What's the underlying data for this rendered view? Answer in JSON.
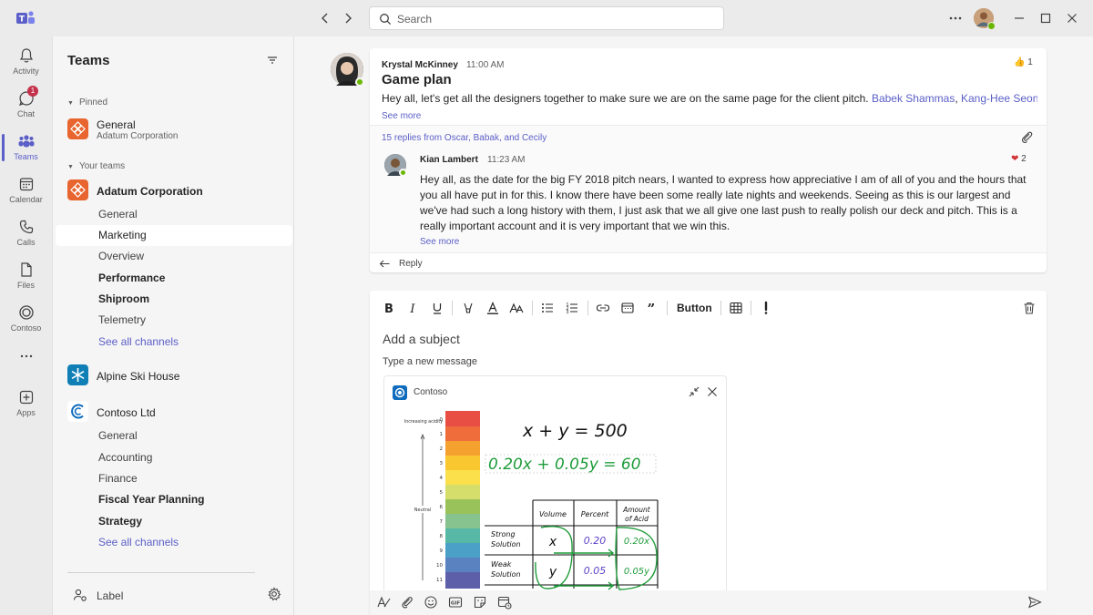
{
  "search": {
    "placeholder": "Search"
  },
  "rail": {
    "items": [
      {
        "label": "Activity",
        "icon": "bell-icon"
      },
      {
        "label": "Chat",
        "icon": "chat-icon",
        "badge": "1"
      },
      {
        "label": "Teams",
        "icon": "teams-icon"
      },
      {
        "label": "Calendar",
        "icon": "calendar-icon"
      },
      {
        "label": "Calls",
        "icon": "phone-icon"
      },
      {
        "label": "Files",
        "icon": "file-icon"
      },
      {
        "label": "Contoso",
        "icon": "contoso-icon"
      },
      {
        "label": "Apps",
        "icon": "plus-icon"
      }
    ]
  },
  "panel": {
    "title": "Teams",
    "pinned_label": "Pinned",
    "pinned": {
      "name": "General",
      "sub": "Adatum Corporation"
    },
    "your_teams_label": "Your teams",
    "teams": [
      {
        "name": "Adatum Corporation",
        "channels": [
          "General",
          "Marketing",
          "Overview",
          "Performance",
          "Shiproom",
          "Telemetry"
        ],
        "see_all": "See all channels"
      },
      {
        "name": "Alpine Ski House"
      },
      {
        "name": "Contoso Ltd",
        "channels": [
          "General",
          "Accounting",
          "Finance",
          "Fiscal Year Planning",
          "Strategy"
        ],
        "see_all": "See all channels"
      }
    ],
    "footer_label": "Label"
  },
  "post": {
    "author": "Krystal McKinney",
    "time": "11:00 AM",
    "title": "Game plan",
    "body": "Hey all, let's get all the designers together to make sure we are on the same page for the client pitch.",
    "mention1": "Babek Shammas",
    "mention2": "Kang-Hee Seong",
    "mention_sep": ", ",
    "mention_trail": ",",
    "see_more": "See more",
    "likes": "1",
    "replies_link": "15 replies from Oscar, Babak, and Cecily"
  },
  "reply": {
    "author": "Kian Lambert",
    "time": "11:23 AM",
    "hearts": "2",
    "body": "Hey all, as the date for the big FY 2018 pitch nears, I wanted to express how appreciative I am of all of you and the hours that you all have put in for this. I know there have been some really late nights and weekends. Seeing as this is our largest and we've had such a long history with them, I just ask that we all give one last push to really polish our deck and pitch. This is a really important account and it is very important that we win this.",
    "see_more": "See more",
    "reply_label": "Reply"
  },
  "compose": {
    "button_label": "Button",
    "subject_placeholder": "Add a subject",
    "message_placeholder": "Type a new message",
    "loop_title": "Contoso"
  },
  "sketch": {
    "scale_top_label": "Increasing acidity",
    "scale_mid_label": "Neutral",
    "scale_numbers": [
      "0",
      "1",
      "2",
      "3",
      "4",
      "5",
      "6",
      "7",
      "8",
      "9",
      "10",
      "11"
    ],
    "eq1": "x + y = 500",
    "eq2": "0.20x + 0.05y = 60",
    "headers": [
      "Volume",
      "Percent",
      "Amount",
      "of Acid"
    ],
    "row1_label": [
      "Strong",
      "Solution"
    ],
    "row2_label": [
      "Weak",
      "Solution"
    ],
    "row1": [
      "x",
      "0.20",
      "0.20x"
    ],
    "row2": [
      "y",
      "0.05",
      "0.05y"
    ]
  },
  "colors": {
    "accent": "#5b5fc7",
    "adatum": "#e8652f",
    "presence": "#6bb700",
    "sketch_green": "#1f9c3a",
    "sketch_purple": "#5b3fc7"
  }
}
